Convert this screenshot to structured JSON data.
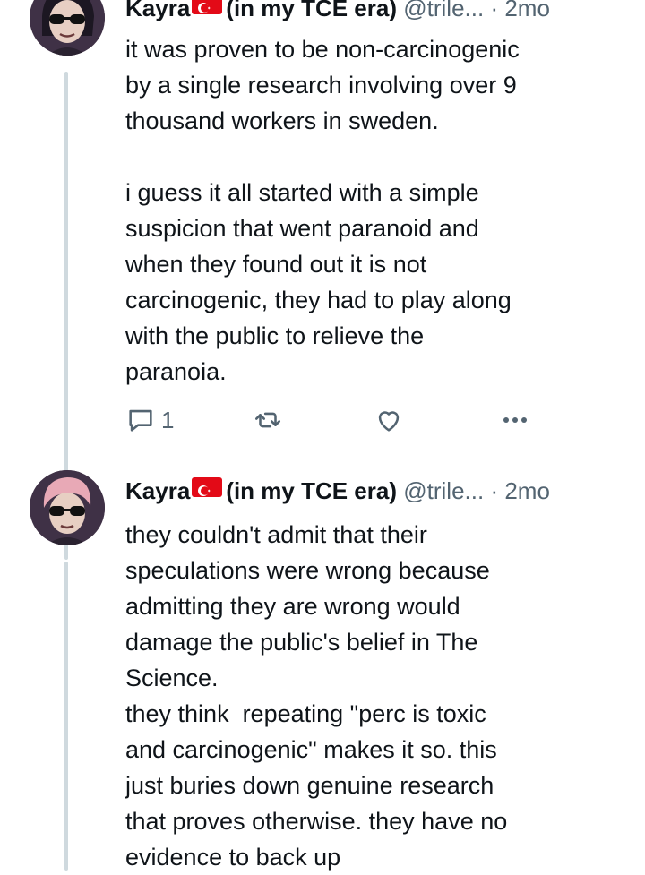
{
  "tweets": [
    {
      "author_name": "Kayra",
      "author_suffix": "(in my TCE era)",
      "handle": "@trile...",
      "separator": "·",
      "time": "2mo",
      "text": "it was proven to be non-carcinogenic\nby a single research involving over 9\nthousand workers in sweden.\n\ni guess it all started with a simple\nsuspicion that went paranoid and\nwhen they found out it is not\ncarcinogenic, they had to play along\nwith the public to relieve the\nparanoia.",
      "reply_count": "1",
      "icons": [
        "reply-icon",
        "retweet-icon",
        "like-icon",
        "more-icon"
      ]
    },
    {
      "author_name": "Kayra",
      "author_suffix": "(in my TCE era)",
      "handle": "@trile...",
      "separator": "·",
      "time": "2mo",
      "text": "they couldn't admit that their\nspeculations were wrong because\nadmitting they are wrong would\ndamage the public's belief in The\nScience.\nthey think  repeating \"perc is toxic\nand carcinogenic\" makes it so. this\njust buries down genuine research\nthat proves otherwise. they have no\nevidence to back up"
    }
  ],
  "colors": {
    "text": "#0f1419",
    "secondary": "#536471",
    "thread_line": "#cfd9de",
    "flag": "#e30a17"
  }
}
